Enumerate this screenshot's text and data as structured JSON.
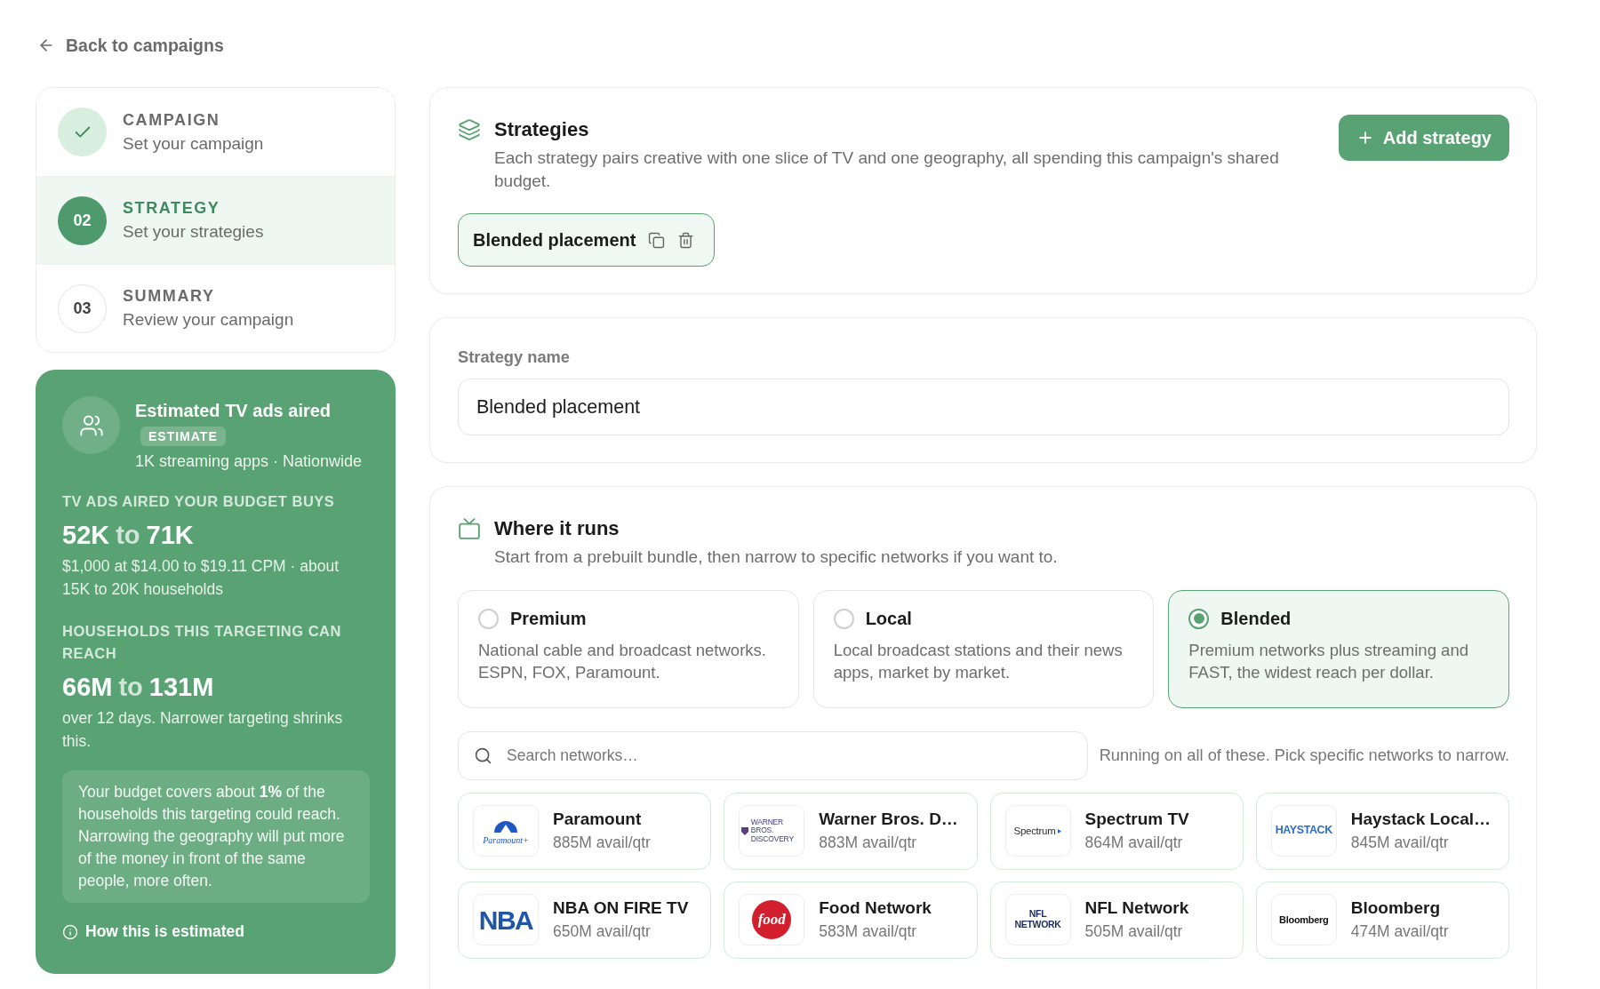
{
  "back_link": {
    "label": "Back to campaigns"
  },
  "steps": [
    {
      "title": "CAMPAIGN",
      "subtitle": "Set your campaign",
      "completed": true,
      "selected": false
    },
    {
      "number": "02",
      "title": "STRATEGY",
      "subtitle": "Set your strategies",
      "completed": false,
      "selected": true
    },
    {
      "number": "03",
      "title": "SUMMARY",
      "subtitle": "Review your campaign",
      "completed": false,
      "selected": false
    }
  ],
  "estimate_panel": {
    "title": "Estimated TV ads aired",
    "badge": "ESTIMATE",
    "subtitle": "1K streaming apps · Nationwide",
    "metrics": [
      {
        "label": "TV ADS AIRED YOUR BUDGET BUYS",
        "low": "52K",
        "joiner": "to",
        "high": "71K",
        "note": "$1,000 at $14.00 to $19.11 CPM · about 15K to 20K households"
      },
      {
        "label": "HOUSEHOLDS THIS TARGETING CAN REACH",
        "low": "66M",
        "joiner": "to",
        "high": "131M",
        "note": "over 12 days. Narrower targeting shrinks this."
      }
    ],
    "callout": "Your budget covers about **1%** of the households this targeting could reach. Narrowing the geography will put more of the money in front of the same people, more often.",
    "link": "How this is estimated"
  },
  "strategies": {
    "title": "Strategies",
    "description": "Each strategy pairs creative with one slice of TV and one geography, all spending this campaign's shared budget.",
    "add_button": "Add strategy",
    "items": [
      {
        "name": "Blended placement",
        "selected": true
      }
    ]
  },
  "strategy_name": {
    "label": "Strategy name",
    "value": "Blended placement"
  },
  "where_it_runs": {
    "title": "Where it runs",
    "description": "Start from a prebuilt bundle, then narrow to specific networks if you want to.",
    "bundles": [
      {
        "title": "Premium",
        "description": "National cable and broadcast networks. ESPN, FOX, Paramount.",
        "selected": false
      },
      {
        "title": "Local",
        "description": "Local broadcast stations and their news apps, market by market.",
        "selected": false
      },
      {
        "title": "Blended",
        "description": "Premium networks plus streaming and FAST, the widest reach per dollar.",
        "selected": true
      }
    ],
    "search": {
      "placeholder": "Search networks…"
    },
    "hint": "Running on all of these. Pick specific networks to narrow.",
    "networks": [
      {
        "name": "Paramount",
        "avails": "885M avail/qtr",
        "logo": {
          "kind": "mountain",
          "text": "Paramount+"
        }
      },
      {
        "name": "Warner Bros. D…",
        "avails": "883M avail/qtr",
        "logo": {
          "kind": "shield",
          "text": "WARNER BROS. DISCOVERY"
        }
      },
      {
        "name": "Spectrum TV",
        "avails": "864M avail/qtr",
        "logo": {
          "kind": "arrow",
          "text": "Spectrum"
        }
      },
      {
        "name": "Haystack Local…",
        "avails": "845M avail/qtr",
        "logo": {
          "kind": "block",
          "text": "HAYSTACK"
        }
      },
      {
        "name": "NBA ON FIRE TV",
        "avails": "650M avail/qtr",
        "logo": {
          "kind": "big",
          "text": "NBA"
        }
      },
      {
        "name": "Food Network",
        "avails": "583M avail/qtr",
        "logo": {
          "kind": "disc",
          "text": "food"
        }
      },
      {
        "name": "NFL Network",
        "avails": "505M avail/qtr",
        "logo": {
          "kind": "stacked",
          "text": "NFL NETWORK"
        }
      },
      {
        "name": "Bloomberg",
        "avails": "474M avail/qtr",
        "logo": {
          "kind": "plain",
          "text": "Bloomberg"
        }
      }
    ]
  }
}
